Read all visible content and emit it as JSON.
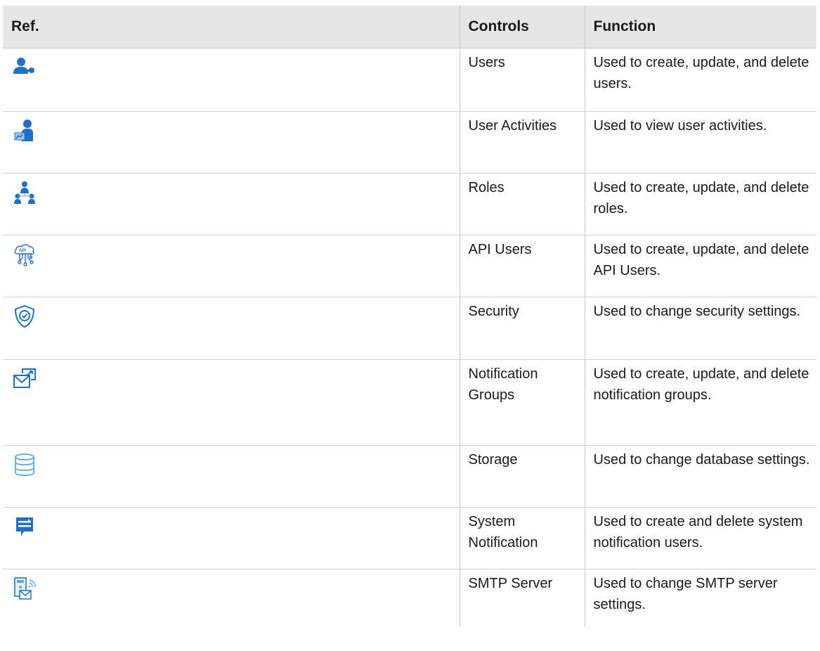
{
  "table": {
    "headers": {
      "ref": "Ref.",
      "controls": "Controls",
      "function": "Function"
    },
    "rows": [
      {
        "icon": "user-key-icon",
        "controls": "Users",
        "function": "Used to create, update, and delete users."
      },
      {
        "icon": "user-activity-icon",
        "controls": "User Activities",
        "function": "Used to view user activities."
      },
      {
        "icon": "roles-hierarchy-icon",
        "controls": "Roles",
        "function": "Used to create, update, and delete roles."
      },
      {
        "icon": "api-cloud-icon",
        "controls": "API Users",
        "function": "Used to create, update, and delete API Users."
      },
      {
        "icon": "security-shield-icon",
        "controls": "Security",
        "function": "Used to change security settings."
      },
      {
        "icon": "notification-envelope-icon",
        "controls": "Notification Groups",
        "function": "Used to create, update, and delete notification groups."
      },
      {
        "icon": "database-storage-icon",
        "controls": "Storage",
        "function": "Used to change database settings."
      },
      {
        "icon": "system-notification-icon",
        "controls": "System Notification",
        "function": "Used to create and delete system notification users."
      },
      {
        "icon": "smtp-server-icon",
        "controls": "SMTP Server",
        "function": "Used to change SMTP server settings."
      }
    ]
  },
  "colors": {
    "icon_dark_blue": "#1f6fc5",
    "icon_light_blue": "#5aa9e6",
    "header_bg": "#e6e6e6",
    "border": "#c8c8c8"
  }
}
